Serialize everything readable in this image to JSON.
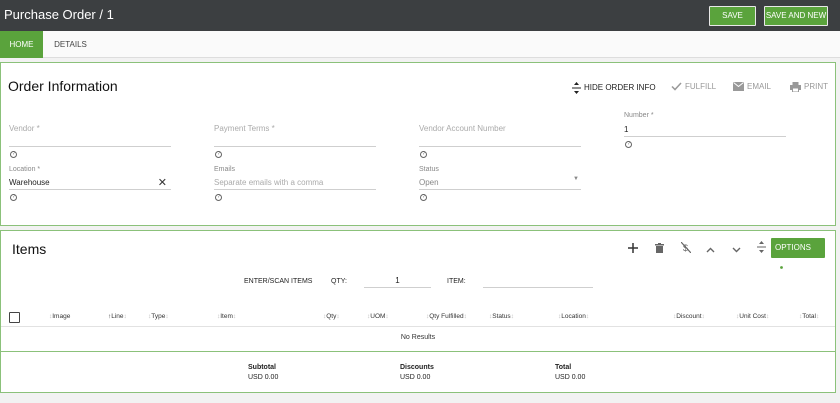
{
  "header": {
    "title": "Purchase Order / 1",
    "save": "SAVE",
    "save_new": "SAVE AND NEW"
  },
  "tabs": [
    {
      "label": "HOME"
    },
    {
      "label": "DETAILS"
    }
  ],
  "order_info": {
    "title": "Order Information",
    "actions": {
      "hide": "HIDE ORDER INFO",
      "fulfill": "FULFILL",
      "email": "EMAIL",
      "print": "PRINT"
    },
    "fields": {
      "vendor": {
        "label": "Vendor *",
        "value": ""
      },
      "payment_terms": {
        "label": "Payment Terms *",
        "value": ""
      },
      "vendor_account": {
        "label": "Vendor Account Number",
        "value": ""
      },
      "number": {
        "label": "Number *",
        "value": "1"
      },
      "location": {
        "label": "Location *",
        "value": "Warehouse"
      },
      "emails": {
        "label": "Emails",
        "placeholder": "Separate emails with a comma"
      },
      "status": {
        "label": "Status",
        "value": "Open"
      }
    },
    "help_glyph": "?"
  },
  "items": {
    "title": "Items",
    "options_label": "OPTIONS",
    "scan": {
      "label": "ENTER/SCAN ITEMS",
      "qty_label": "QTY:",
      "qty_value": "1",
      "item_label": "ITEM:"
    },
    "columns": [
      "Image",
      "Line",
      "Type",
      "Item",
      "Qty",
      "UOM",
      "Qty Fulfilled",
      "Status",
      "Location",
      "Discount",
      "Unit Cost",
      "Total"
    ],
    "empty": "No Results",
    "totals": {
      "subtotal_label": "Subtotal",
      "subtotal_value": "USD 0.00",
      "discounts_label": "Discounts",
      "discounts_value": "USD 0.00",
      "total_label": "Total",
      "total_value": "USD 0.00"
    }
  },
  "colors": {
    "accent": "#5aa33c",
    "header_bg": "#3c3f41",
    "panel_border": "#8bc17a"
  }
}
